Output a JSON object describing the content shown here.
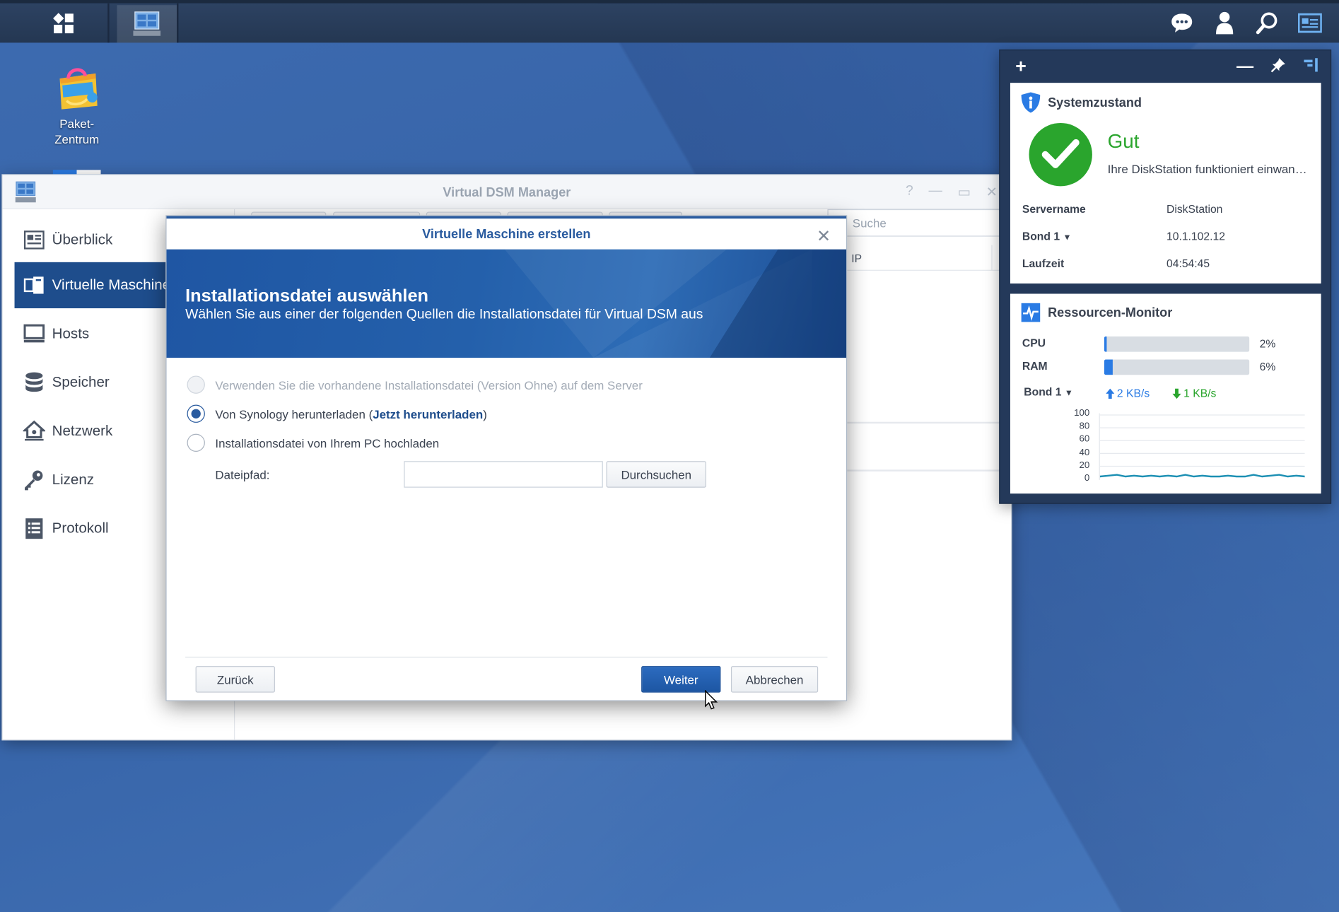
{
  "desktop": {
    "icon_label_line1": "Paket-",
    "icon_label_line2": "Zentrum"
  },
  "window": {
    "title": "Virtual DSM Manager",
    "search_placeholder": "Suche",
    "column_ip": "IP",
    "nav": [
      {
        "label": "Überblick",
        "icon": "overview-icon"
      },
      {
        "label": "Virtuelle Maschine",
        "icon": "virtual-machine-icon"
      },
      {
        "label": "Hosts",
        "icon": "monitor-icon"
      },
      {
        "label": "Speicher",
        "icon": "database-icon"
      },
      {
        "label": "Netzwerk",
        "icon": "network-home-icon"
      },
      {
        "label": "Lizenz",
        "icon": "key-icon"
      },
      {
        "label": "Protokoll",
        "icon": "log-list-icon"
      }
    ],
    "active_nav_index": 1
  },
  "dialog": {
    "title": "Virtuelle Maschine erstellen",
    "heading": "Installationsdatei auswählen",
    "subheading": "Wählen Sie aus einer der folgenden Quellen die Installationsdatei für Virtual DSM aus",
    "options": {
      "existing": "Verwenden Sie die vorhandene Installationsdatei (Version Ohne) auf dem Server",
      "download_prefix": "Von Synology herunterladen (",
      "download_link": "Jetzt herunterladen",
      "download_suffix": ")",
      "upload": "Installationsdatei von Ihrem PC hochladen"
    },
    "selected_option": "download",
    "file_path_label": "Dateipfad:",
    "file_path_value": "",
    "browse_button": "Durchsuchen",
    "back_button": "Zurück",
    "next_button": "Weiter",
    "cancel_button": "Abbrechen"
  },
  "widgets": {
    "health": {
      "title": "Systemzustand",
      "status": "Gut",
      "message": "Ihre DiskStation funktioniert einwan…",
      "rows": [
        {
          "key": "Servername",
          "value": "DiskStation"
        },
        {
          "key": "Bond 1",
          "value": "10.1.102.12"
        },
        {
          "key": "Laufzeit",
          "value": "04:54:45"
        }
      ]
    },
    "resources": {
      "title": "Ressourcen-Monitor",
      "cpu_label": "CPU",
      "cpu_percent": 2,
      "cpu_text": "2%",
      "ram_label": "RAM",
      "ram_percent": 6,
      "ram_text": "6%",
      "net_label": "Bond 1",
      "upload": "2 KB/s",
      "download": "1 KB/s",
      "y_ticks": [
        "100",
        "80",
        "60",
        "40",
        "20",
        "0"
      ],
      "colors": {
        "up": "#2a7be4",
        "down": "#2aa52d",
        "bar": "#2a7be4"
      }
    }
  }
}
